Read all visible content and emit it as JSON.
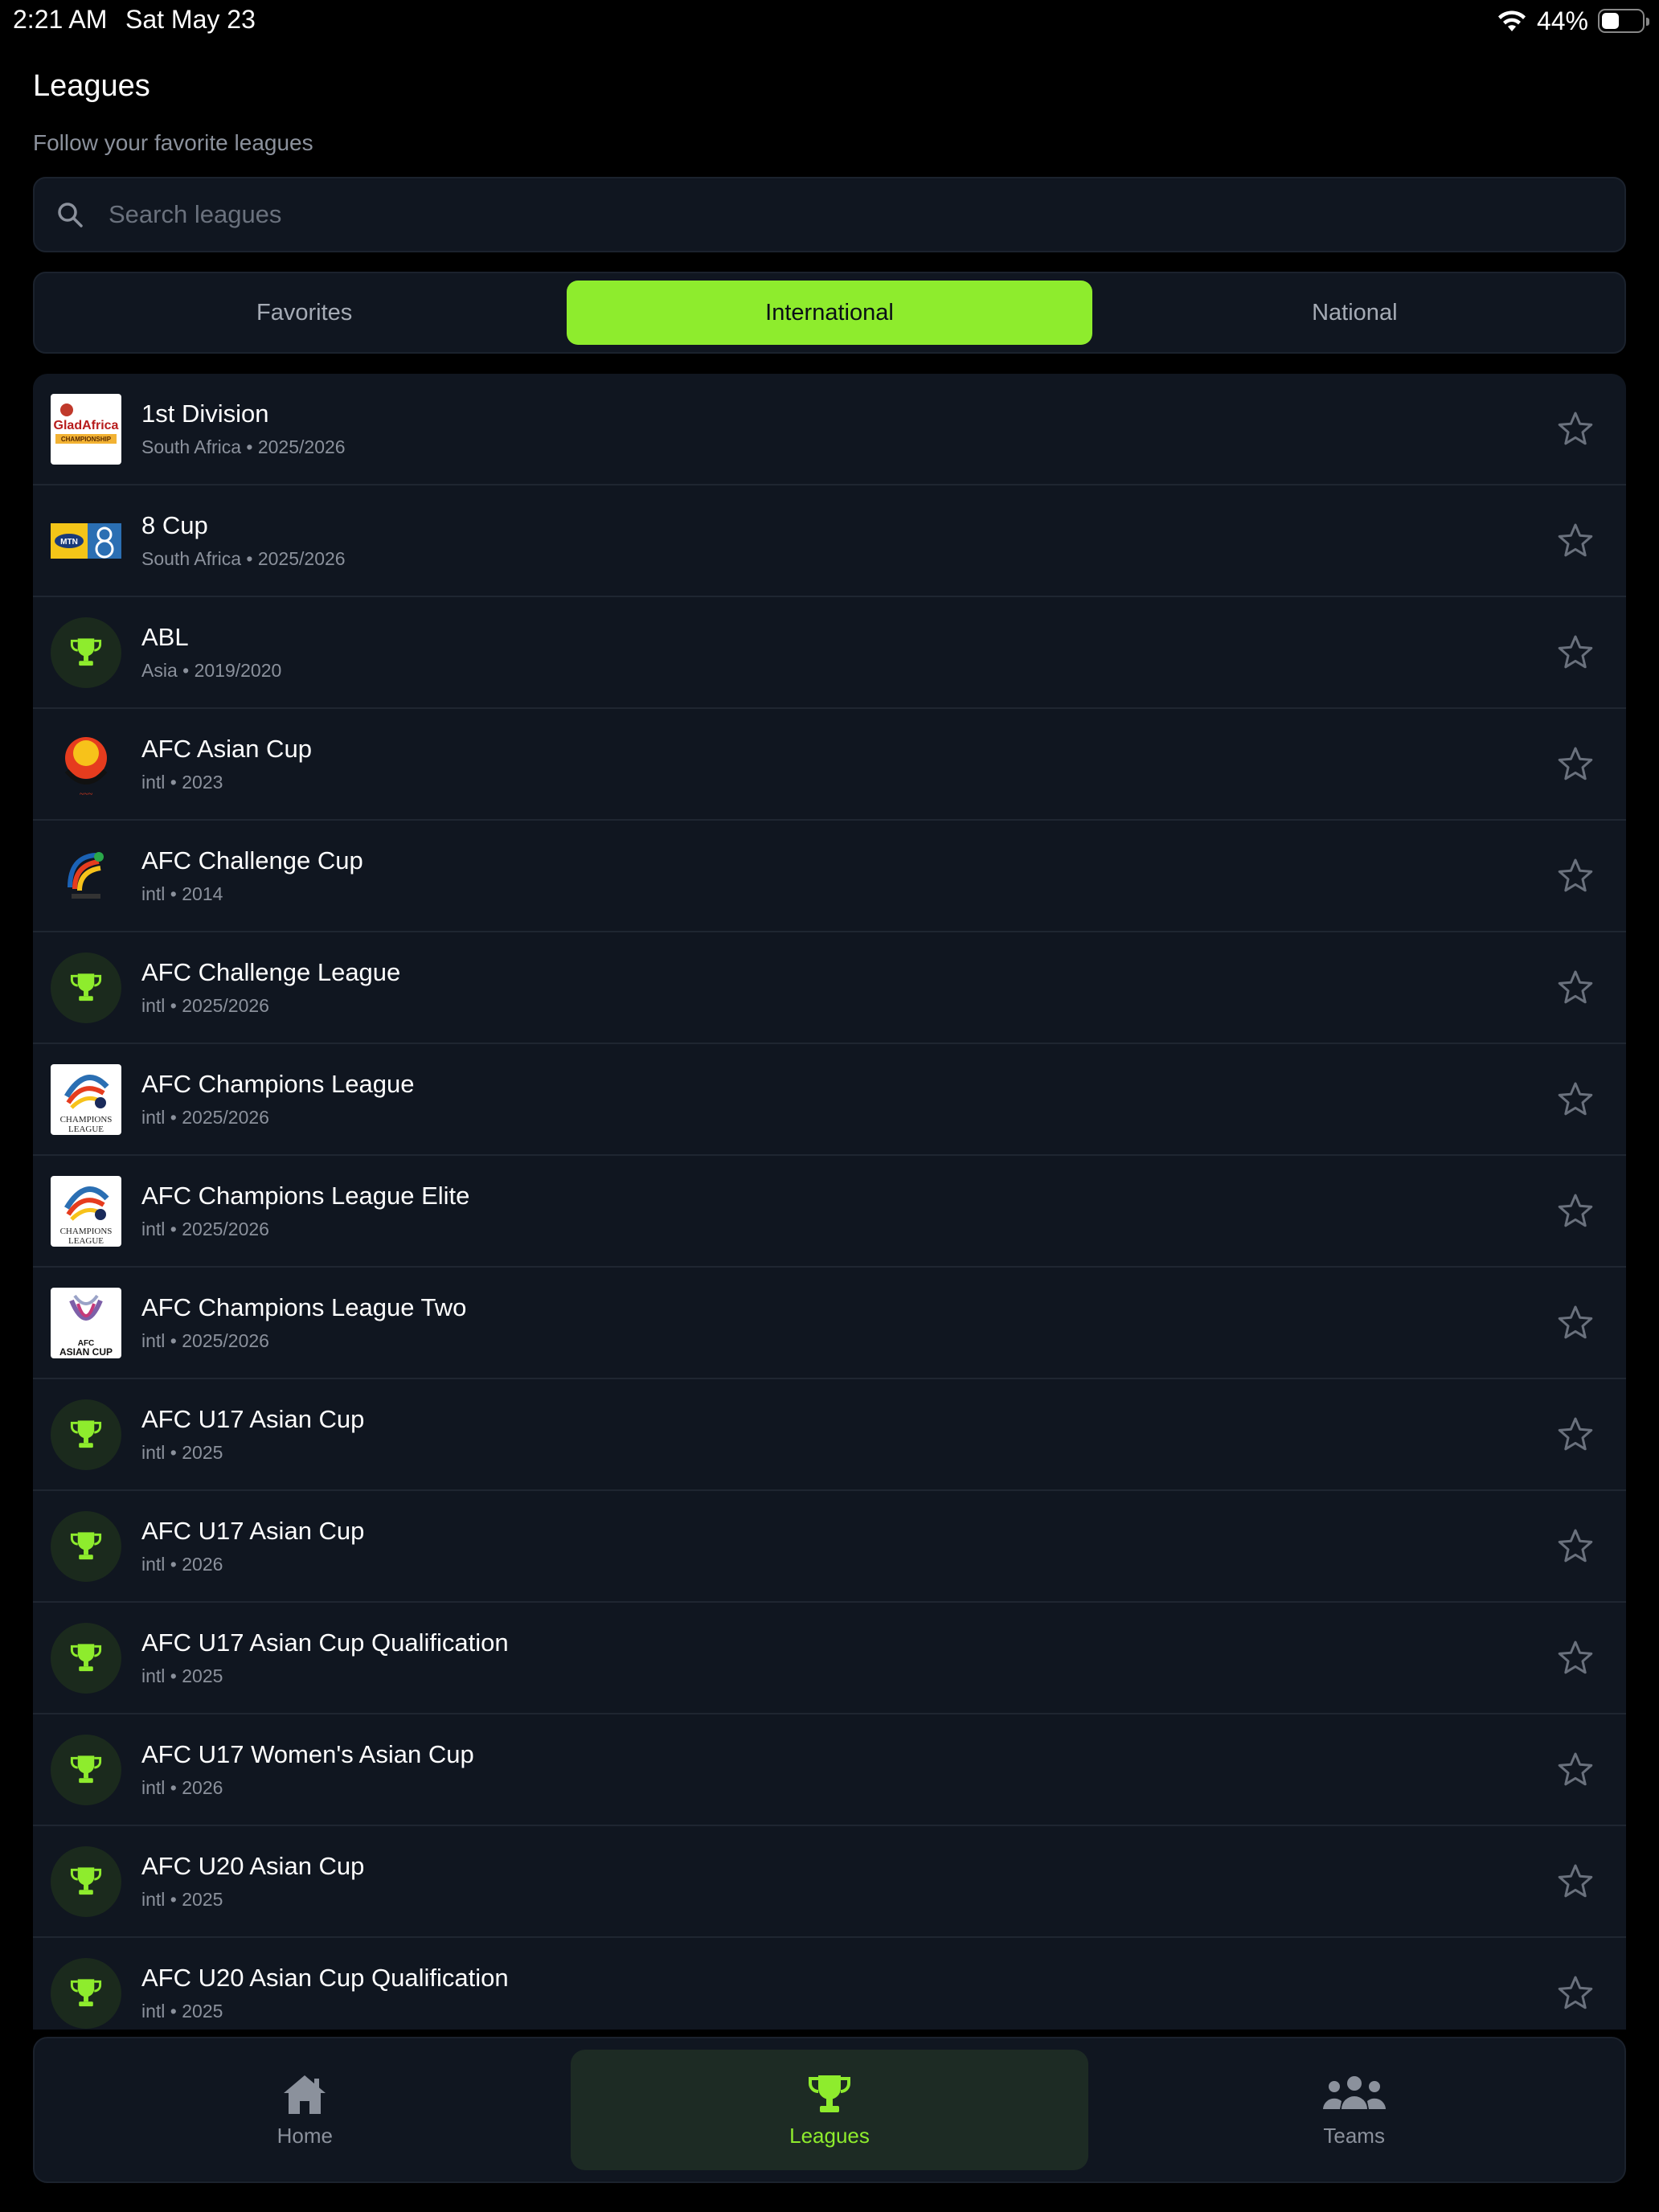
{
  "status": {
    "time": "2:21 AM",
    "date": "Sat May 23",
    "battery": "44%",
    "battery_level": 0.44
  },
  "header": {
    "title": "Leagues",
    "subtitle": "Follow your favorite leagues"
  },
  "search": {
    "placeholder": "Search leagues",
    "value": ""
  },
  "tabs": [
    {
      "label": "Favorites",
      "active": false
    },
    {
      "label": "International",
      "active": true
    },
    {
      "label": "National",
      "active": false
    }
  ],
  "leagues": [
    {
      "name": "1st Division",
      "meta": "South Africa • 2025/2026",
      "logo": "gladafrica-logo",
      "favorite": false
    },
    {
      "name": "8 Cup",
      "meta": "South Africa • 2025/2026",
      "logo": "mtn8-logo",
      "favorite": false
    },
    {
      "name": "ABL",
      "meta": "Asia • 2019/2020",
      "logo": "trophy",
      "favorite": false
    },
    {
      "name": "AFC Asian Cup",
      "meta": "intl • 2023",
      "logo": "afc-asian-cup-logo",
      "favorite": false
    },
    {
      "name": "AFC Challenge Cup",
      "meta": "intl • 2014",
      "logo": "afc-challenge-cup-logo",
      "favorite": false
    },
    {
      "name": "AFC Challenge League",
      "meta": "intl • 2025/2026",
      "logo": "trophy",
      "favorite": false
    },
    {
      "name": "AFC Champions League",
      "meta": "intl • 2025/2026",
      "logo": "afc-champions-league-logo",
      "favorite": false
    },
    {
      "name": "AFC Champions League Elite",
      "meta": "intl • 2025/2026",
      "logo": "afc-champions-league-logo",
      "favorite": false
    },
    {
      "name": "AFC Champions League Two",
      "meta": "intl • 2025/2026",
      "logo": "afc-asian-cup-white-logo",
      "favorite": false
    },
    {
      "name": "AFC U17 Asian Cup",
      "meta": "intl • 2025",
      "logo": "trophy",
      "favorite": false
    },
    {
      "name": "AFC U17 Asian Cup",
      "meta": "intl • 2026",
      "logo": "trophy",
      "favorite": false
    },
    {
      "name": "AFC U17 Asian Cup Qualification",
      "meta": "intl • 2025",
      "logo": "trophy",
      "favorite": false
    },
    {
      "name": "AFC U17 Women's Asian Cup",
      "meta": "intl • 2026",
      "logo": "trophy",
      "favorite": false
    },
    {
      "name": "AFC U20 Asian Cup",
      "meta": "intl • 2025",
      "logo": "trophy",
      "favorite": false
    },
    {
      "name": "AFC U20 Asian Cup Qualification",
      "meta": "intl • 2025",
      "logo": "trophy",
      "favorite": false
    }
  ],
  "logo_text": {
    "gladafrica": "GladAfrica",
    "gladafrica_sub": "CHAMPIONSHIP",
    "mtn": "MTN",
    "champions": "CHAMPIONS",
    "league": "LEAGUE",
    "afc": "AFC",
    "asian_cup": "ASIAN CUP"
  },
  "nav": [
    {
      "label": "Home",
      "icon": "home-icon",
      "active": false
    },
    {
      "label": "Leagues",
      "icon": "trophy-icon",
      "active": true
    },
    {
      "label": "Teams",
      "icon": "people-icon",
      "active": false
    }
  ],
  "colors": {
    "accent": "#8eec2d",
    "background": "#000000",
    "card": "#101620",
    "muted": "#8b919c"
  }
}
